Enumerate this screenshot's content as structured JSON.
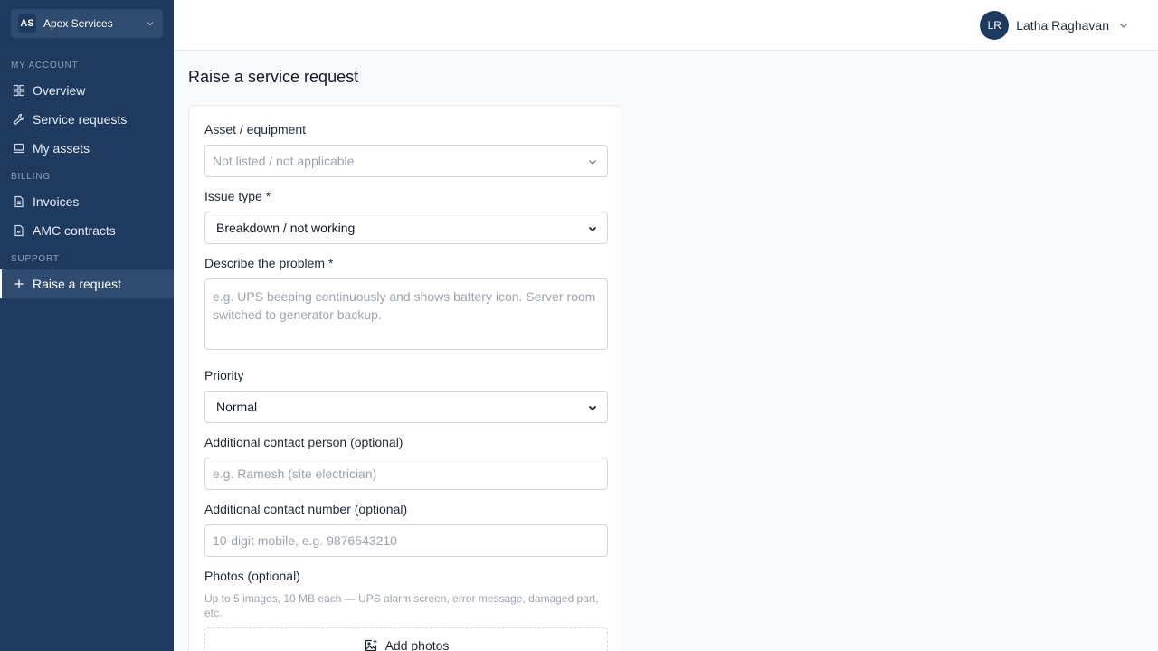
{
  "org": {
    "initials": "AS",
    "name": "Apex Services"
  },
  "user": {
    "initials": "LR",
    "name": "Latha Raghavan"
  },
  "sidebar": {
    "sections": {
      "my_account": "MY ACCOUNT",
      "billing": "BILLING",
      "support": "SUPPORT"
    },
    "items": [
      {
        "label": "Overview",
        "icon": "grid-icon"
      },
      {
        "label": "Service requests",
        "icon": "wrench-icon"
      },
      {
        "label": "My assets",
        "icon": "laptop-icon"
      },
      {
        "label": "Invoices",
        "icon": "document-icon"
      },
      {
        "label": "AMC contracts",
        "icon": "document-check-icon"
      },
      {
        "label": "Raise a request",
        "icon": "plus-icon",
        "active": true
      }
    ]
  },
  "page": {
    "title": "Raise a service request"
  },
  "form": {
    "asset": {
      "label": "Asset / equipment",
      "value": "Not listed / not applicable"
    },
    "issue_type": {
      "label": "Issue type *",
      "value": "Breakdown / not working"
    },
    "problem": {
      "label": "Describe the problem *",
      "placeholder": "e.g. UPS beeping continuously and shows battery icon. Server room switched to generator backup."
    },
    "priority": {
      "label": "Priority",
      "value": "Normal"
    },
    "contact_person": {
      "label": "Additional contact person (optional)",
      "placeholder": "e.g. Ramesh (site electrician)"
    },
    "contact_number": {
      "label": "Additional contact number (optional)",
      "placeholder": "10-digit mobile, e.g. 9876543210"
    },
    "photos": {
      "label": "Photos (optional)",
      "hint": "Up to 5 images, 10 MB each — UPS alarm screen, error message, damaged part, etc.",
      "button": "Add photos"
    }
  }
}
